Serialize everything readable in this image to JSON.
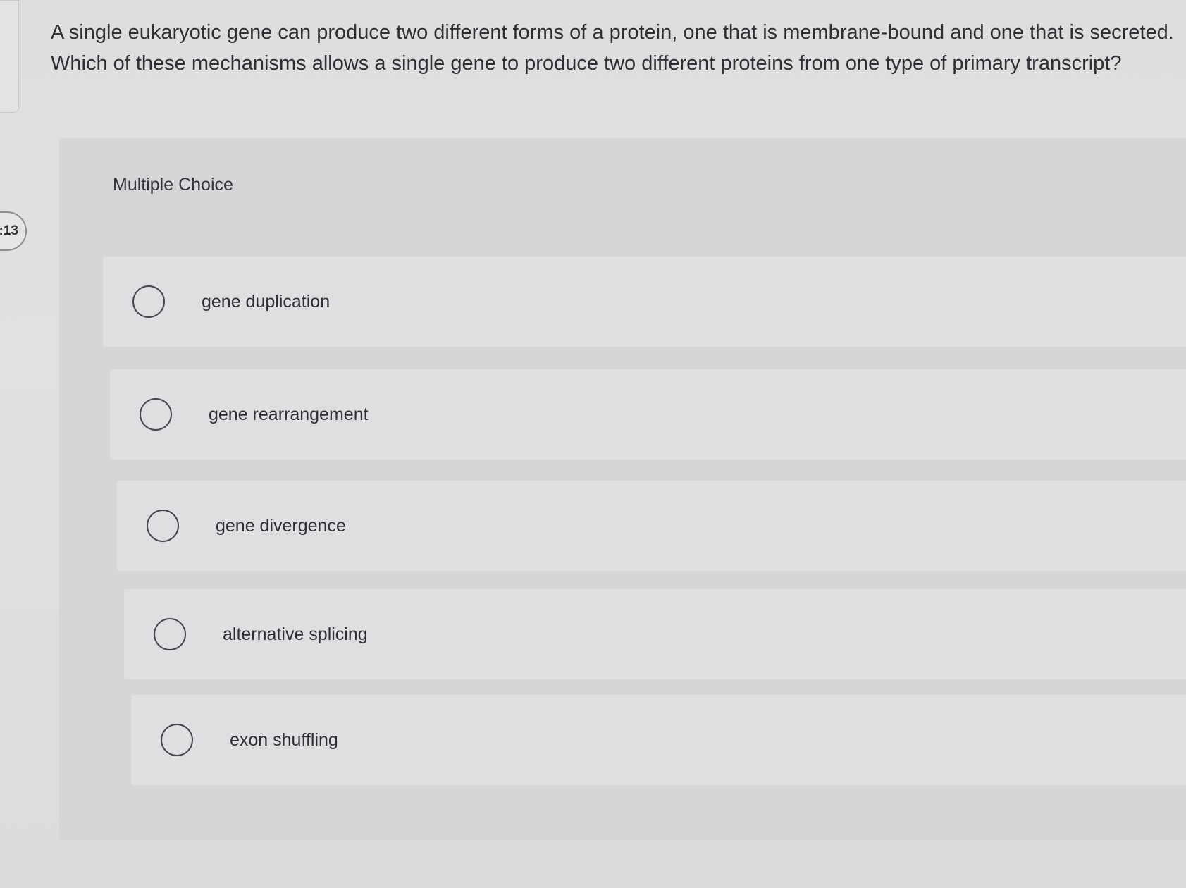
{
  "timer": {
    "text": ":13"
  },
  "question": {
    "text": "A single eukaryotic gene can produce two different forms of a protein, one that is membrane-bound and one that is secreted. Which of these mechanisms allows a single gene to produce two different proteins from one type of primary transcript?"
  },
  "panel": {
    "label": "Multiple Choice"
  },
  "options": [
    {
      "label": "gene duplication",
      "selected": false
    },
    {
      "label": "gene rearrangement",
      "selected": false
    },
    {
      "label": "gene divergence",
      "selected": false
    },
    {
      "label": "alternative splicing",
      "selected": false
    },
    {
      "label": "exon shuffling",
      "selected": false
    }
  ]
}
